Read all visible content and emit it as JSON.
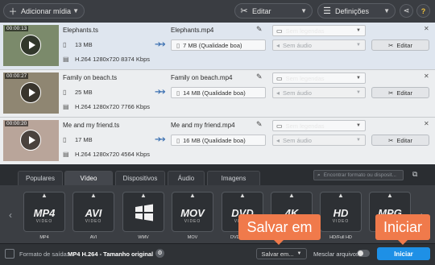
{
  "toolbar": {
    "add_media": "Adicionar mídia",
    "edit": "Editar",
    "settings": "Definições",
    "help": "?"
  },
  "files": [
    {
      "duration": "00:00:13",
      "name": "Elephants.ts",
      "size": "13 MB",
      "video_info": "H.264 1280x720 8374 Kbps",
      "output_name": "Elephants.mp4",
      "output_size": "7 MB (Qualidade boa)",
      "subtitles": "Sem legendas",
      "audio": "Sem áudio",
      "edit_label": "Editar",
      "thumb_color": "#7b8a6b"
    },
    {
      "duration": "00:00:27",
      "name": "Family on beach.ts",
      "size": "25 MB",
      "video_info": "H.264 1280x720 7766 Kbps",
      "output_name": "Family on beach.mp4",
      "output_size": "14 MB (Qualidade boa)",
      "subtitles": "Sem legendas",
      "audio": "Sem áudio",
      "edit_label": "Editar",
      "thumb_color": "#8f8672"
    },
    {
      "duration": "00:00:20",
      "name": "Me and my friend.ts",
      "size": "17 MB",
      "video_info": "H.264 1280x720 4564 Kbps",
      "output_name": "Me and my friend.mp4",
      "output_size": "16 MB (Qualidade boa)",
      "subtitles": "Sem legendas",
      "audio": "Sem áudio",
      "edit_label": "Editar",
      "thumb_color": "#b9a59a"
    }
  ],
  "tabs": [
    "Populares",
    "Vídeo",
    "Dispositivos",
    "Áudio",
    "Imagens"
  ],
  "active_tab": "Vídeo",
  "search": {
    "placeholder": "Encontrar formato ou disposit..."
  },
  "formats": [
    {
      "big": "MP4",
      "sub": "VIDEO",
      "caption": "MP4"
    },
    {
      "big": "AVI",
      "sub": "VIDEO",
      "caption": "AVI"
    },
    {
      "big": "",
      "sub": "",
      "caption": "WMV"
    },
    {
      "big": "MOV",
      "sub": "VIDEO",
      "caption": "MOV"
    },
    {
      "big": "DVD",
      "sub": "VIDEO",
      "caption": "DVD - vídeo"
    },
    {
      "big": "4K",
      "sub": "ULTRA HD",
      "caption": "4K"
    },
    {
      "big": "HD",
      "sub": "VIDEO",
      "caption": "HD/Full HD"
    },
    {
      "big": "MPG",
      "sub": "VIDEO",
      "caption": "MPG"
    }
  ],
  "bottom": {
    "output_label": "Formato de saída:",
    "output_value": "MP4 H.264 - Tamanho original",
    "save_to": "Salvar em...",
    "merge_label": "Mesclar arquivos:",
    "start": "Iniciar"
  },
  "callouts": {
    "save": "Salvar em",
    "start": "Iniciar"
  },
  "colors": {
    "accent": "#1e90e6",
    "callout": "#f07a4b"
  }
}
